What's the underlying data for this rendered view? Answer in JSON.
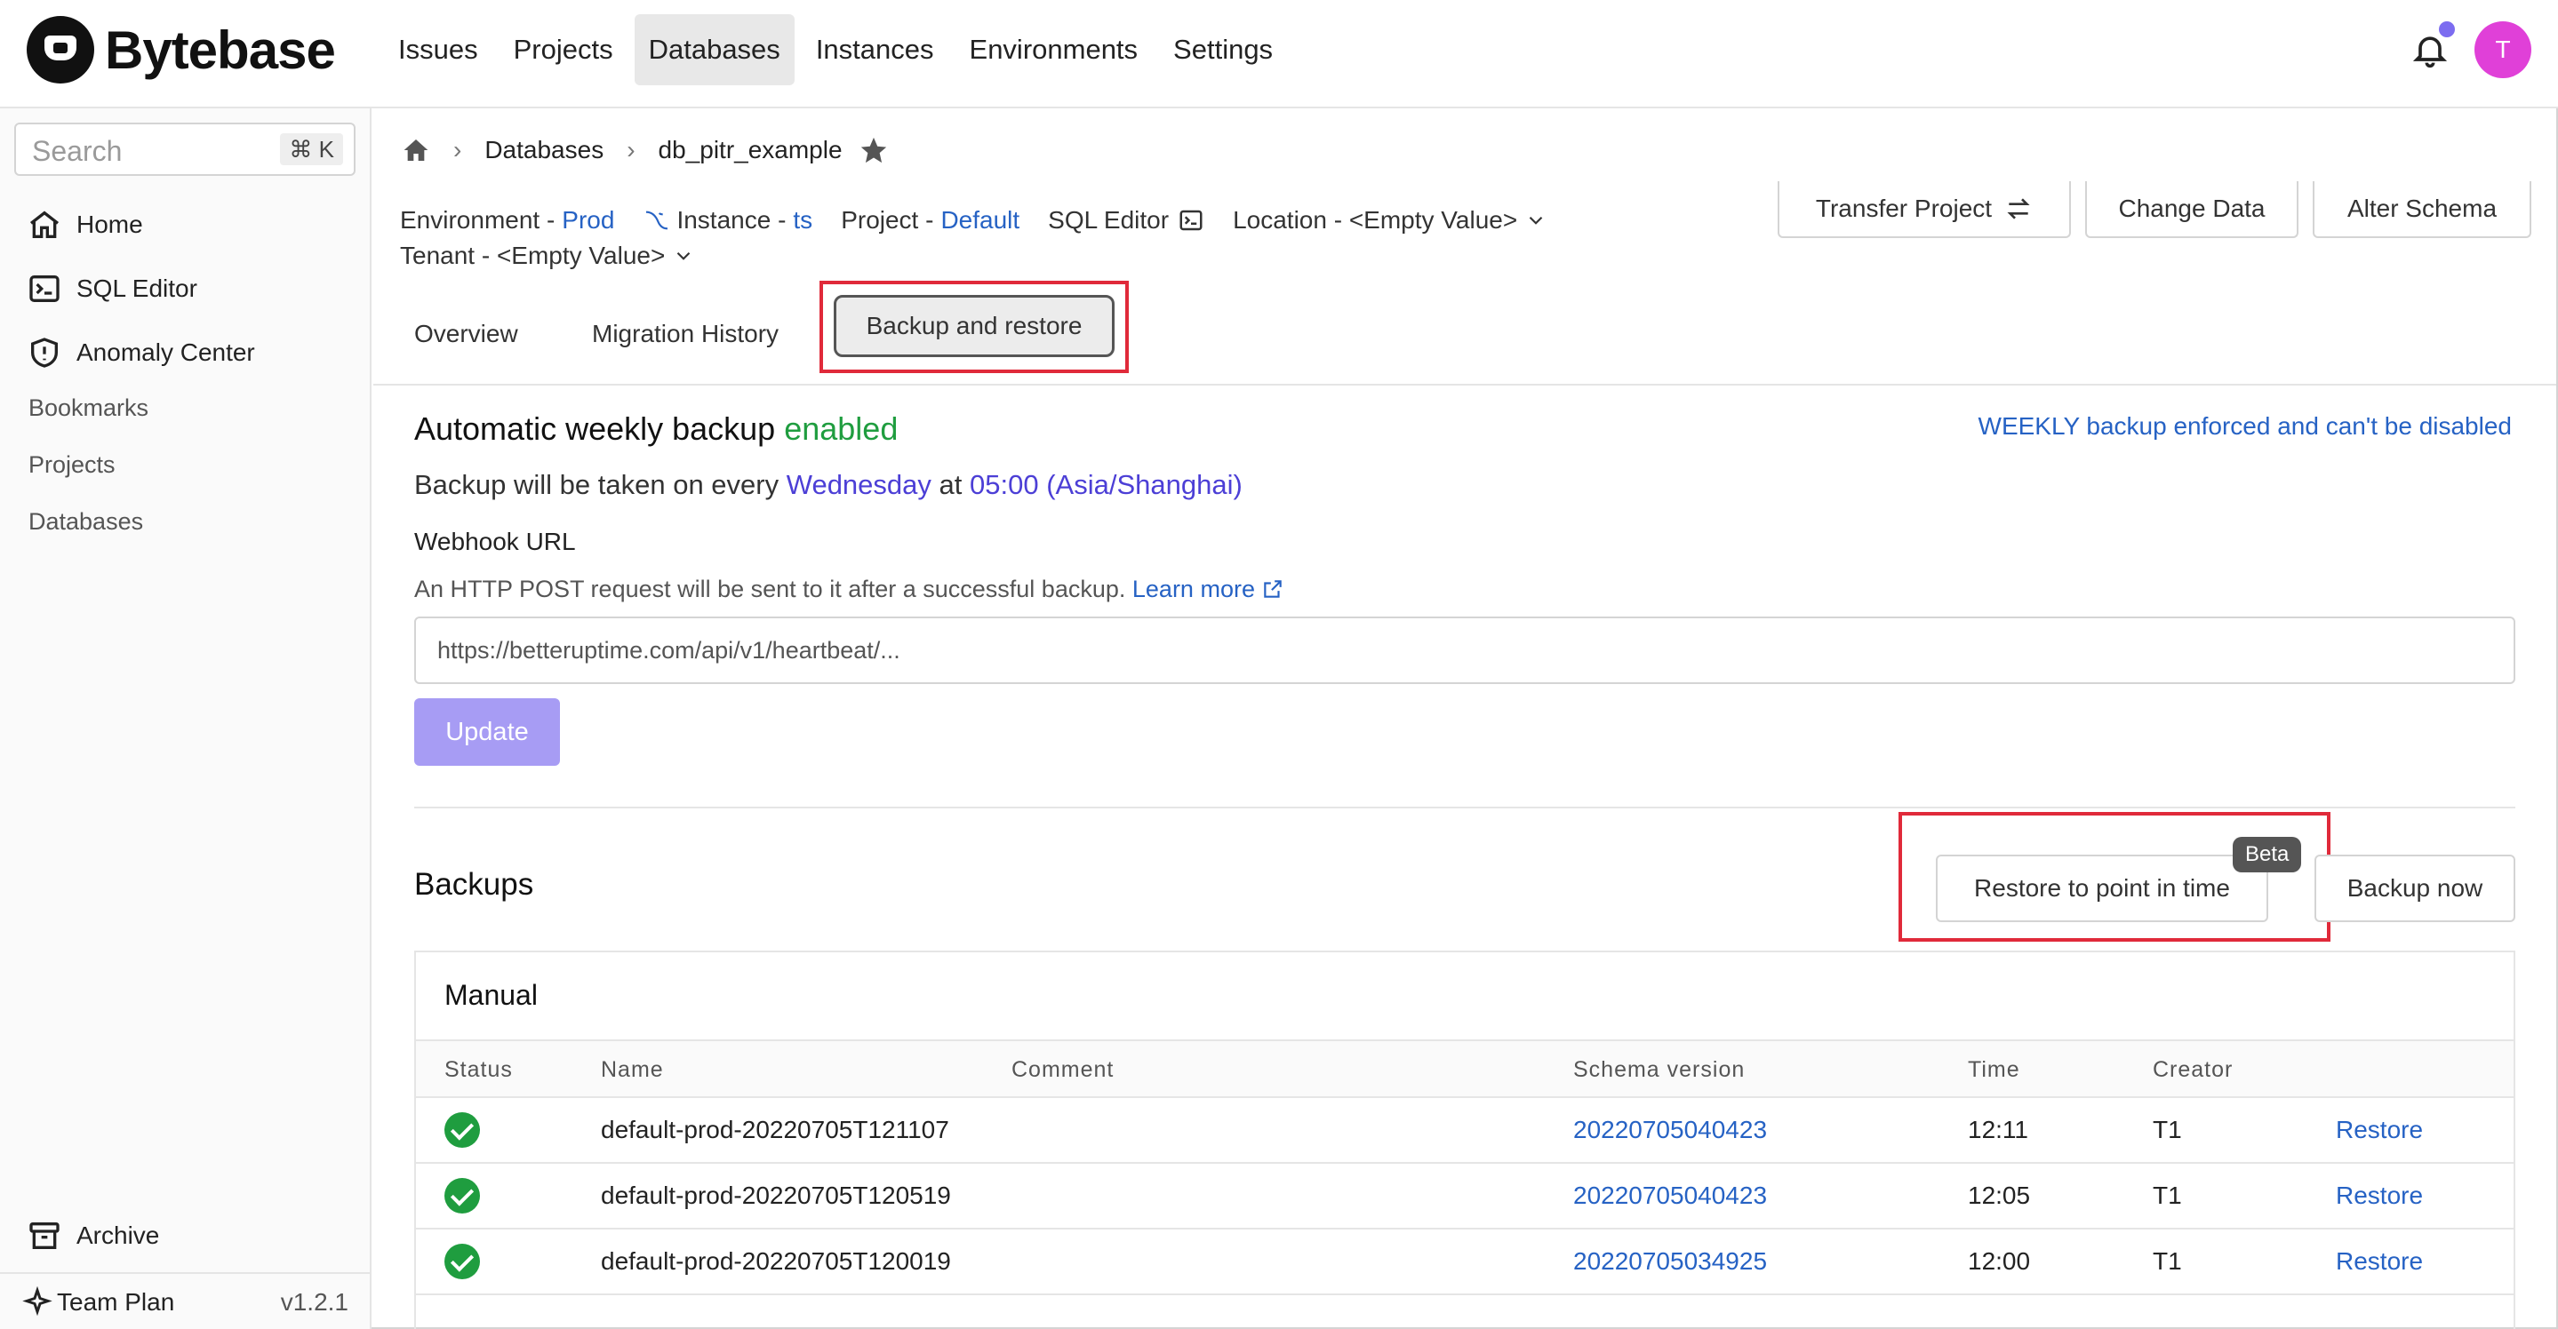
{
  "app": {
    "name": "Bytebase"
  },
  "nav": {
    "items": [
      {
        "label": "Issues"
      },
      {
        "label": "Projects"
      },
      {
        "label": "Databases"
      },
      {
        "label": "Instances"
      },
      {
        "label": "Environments"
      },
      {
        "label": "Settings"
      }
    ],
    "active": "Databases",
    "avatar_initial": "T"
  },
  "sidebar": {
    "search_placeholder": "Search",
    "search_shortcut": "⌘ K",
    "items": [
      {
        "label": "Home",
        "icon": "home-icon"
      },
      {
        "label": "SQL Editor",
        "icon": "terminal-icon"
      },
      {
        "label": "Anomaly Center",
        "icon": "shield-icon"
      }
    ],
    "plain_items": [
      {
        "label": "Bookmarks"
      },
      {
        "label": "Projects"
      },
      {
        "label": "Databases"
      }
    ],
    "archive_label": "Archive",
    "plan_label": "Team Plan",
    "version": "v1.2.1"
  },
  "breadcrumb": {
    "section": "Databases",
    "current": "db_pitr_example"
  },
  "meta": {
    "environment_key": "Environment -",
    "environment_value": "Prod",
    "instance_key": "Instance -",
    "instance_value": "ts",
    "project_key": "Project -",
    "project_value": "Default",
    "sql_editor": "SQL Editor",
    "location": "Location - <Empty Value>",
    "tenant": "Tenant - <Empty Value>"
  },
  "actions": {
    "transfer_project": "Transfer Project",
    "change_data": "Change Data",
    "alter_schema": "Alter Schema"
  },
  "tabs": [
    {
      "label": "Overview"
    },
    {
      "label": "Migration History"
    },
    {
      "label": "Backup and restore"
    }
  ],
  "backup_settings": {
    "title_prefix": "Automatic weekly backup",
    "title_status": "enabled",
    "enforced_note": "WEEKLY backup enforced and can't be disabled",
    "schedule_prefix": "Backup will be taken on every",
    "schedule_day": "Wednesday",
    "schedule_at": "at",
    "schedule_time": "05:00 (Asia/Shanghai)",
    "webhook_label": "Webhook URL",
    "webhook_desc": "An HTTP POST request will be sent to it after a successful backup.",
    "learn_more": "Learn more",
    "webhook_value": "https://betteruptime.com/api/v1/heartbeat/...",
    "update_label": "Update"
  },
  "backups": {
    "title": "Backups",
    "restore_pitr_label": "Restore to point in time",
    "beta_badge": "Beta",
    "backup_now_label": "Backup now",
    "manual_title": "Manual",
    "columns": [
      "Status",
      "Name",
      "Comment",
      "Schema version",
      "Time",
      "Creator"
    ],
    "rows": [
      {
        "name": "default-prod-20220705T121107",
        "comment": "",
        "schema_version": "20220705040423",
        "time": "12:11",
        "creator": "T1",
        "action": "Restore"
      },
      {
        "name": "default-prod-20220705T120519",
        "comment": "",
        "schema_version": "20220705040423",
        "time": "12:05",
        "creator": "T1",
        "action": "Restore"
      },
      {
        "name": "default-prod-20220705T120019",
        "comment": "",
        "schema_version": "20220705034925",
        "time": "12:00",
        "creator": "T1",
        "action": "Restore"
      }
    ]
  },
  "colors": {
    "accent": "#2662c4",
    "success": "#1f9d3f",
    "highlight": "#e02a3a",
    "primary_disabled": "#a79cf4"
  }
}
